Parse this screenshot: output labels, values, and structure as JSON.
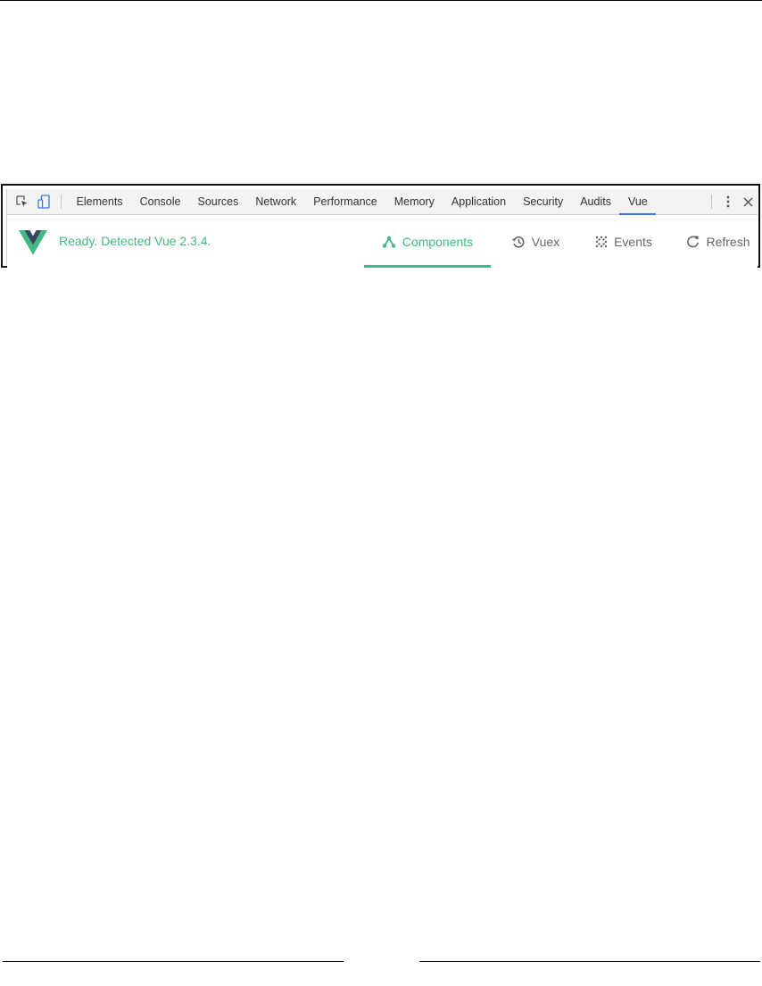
{
  "devtools": {
    "tabs": [
      {
        "label": "Elements"
      },
      {
        "label": "Console"
      },
      {
        "label": "Sources"
      },
      {
        "label": "Network"
      },
      {
        "label": "Performance"
      },
      {
        "label": "Memory"
      },
      {
        "label": "Application"
      },
      {
        "label": "Security"
      },
      {
        "label": "Audits"
      },
      {
        "label": "Vue",
        "active": true
      }
    ],
    "icons": {
      "inspect": "inspect-element-icon",
      "device": "device-toolbar-icon",
      "menu": "kebab-menu-icon",
      "close": "close-icon"
    },
    "colors": {
      "active_underline": "#3879d9"
    }
  },
  "vue_panel": {
    "status": "Ready. Detected Vue 2.3.4.",
    "tabs": [
      {
        "label": "Components",
        "icon": "component-tree-icon",
        "active": true
      },
      {
        "label": "Vuex",
        "icon": "history-icon"
      },
      {
        "label": "Events",
        "icon": "events-dots-icon"
      },
      {
        "label": "Refresh",
        "icon": "refresh-icon"
      }
    ],
    "colors": {
      "accent": "#42b983",
      "logo_dark": "#35495e"
    }
  }
}
